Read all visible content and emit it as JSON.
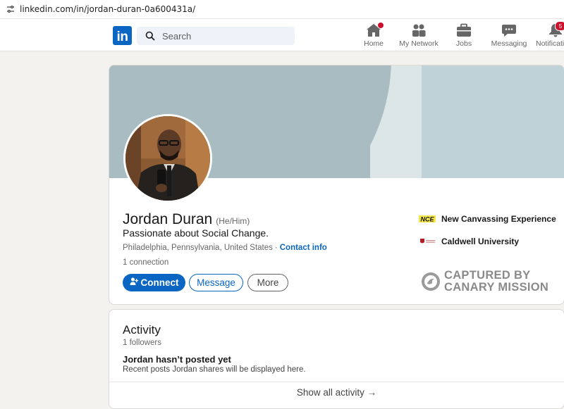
{
  "browser": {
    "url": "linkedin.com/in/jordan-duran-0a600431a/"
  },
  "header": {
    "search_placeholder": "Search",
    "nav": [
      {
        "label": "Home",
        "icon": "home-icon",
        "badge": ""
      },
      {
        "label": "My Network",
        "icon": "network-icon",
        "badge": ""
      },
      {
        "label": "Jobs",
        "icon": "briefcase-icon",
        "badge": ""
      },
      {
        "label": "Messaging",
        "icon": "chat-icon",
        "badge": ""
      },
      {
        "label": "Notifications",
        "icon": "bell-icon",
        "badge": "5"
      }
    ]
  },
  "profile": {
    "name": "Jordan Duran",
    "pronouns": "(He/Him)",
    "headline": "Passionate about Social Change.",
    "location": "Philadelphia, Pennsylvania, United States",
    "separator": "·",
    "contact_info": "Contact info",
    "connections": "1 connection",
    "buttons": {
      "connect": "Connect",
      "message": "Message",
      "more": "More"
    },
    "experience": [
      {
        "name": "New Canvassing Experience",
        "logo_text": "NCE"
      },
      {
        "name": "Caldwell University"
      }
    ]
  },
  "watermark": {
    "line1": "CAPTURED BY",
    "line2": "CANARY MISSION"
  },
  "activity": {
    "title": "Activity",
    "followers": "1 followers",
    "empty_title": "Jordan hasn’t posted yet",
    "empty_subtitle": "Recent posts Jordan shares will be displayed here.",
    "show_all": "Show all activity →"
  },
  "colors": {
    "brand": "#0a66c2",
    "badge": "#cb112d",
    "banner": "#a9bcc1",
    "page_bg": "#f4f2ee"
  }
}
